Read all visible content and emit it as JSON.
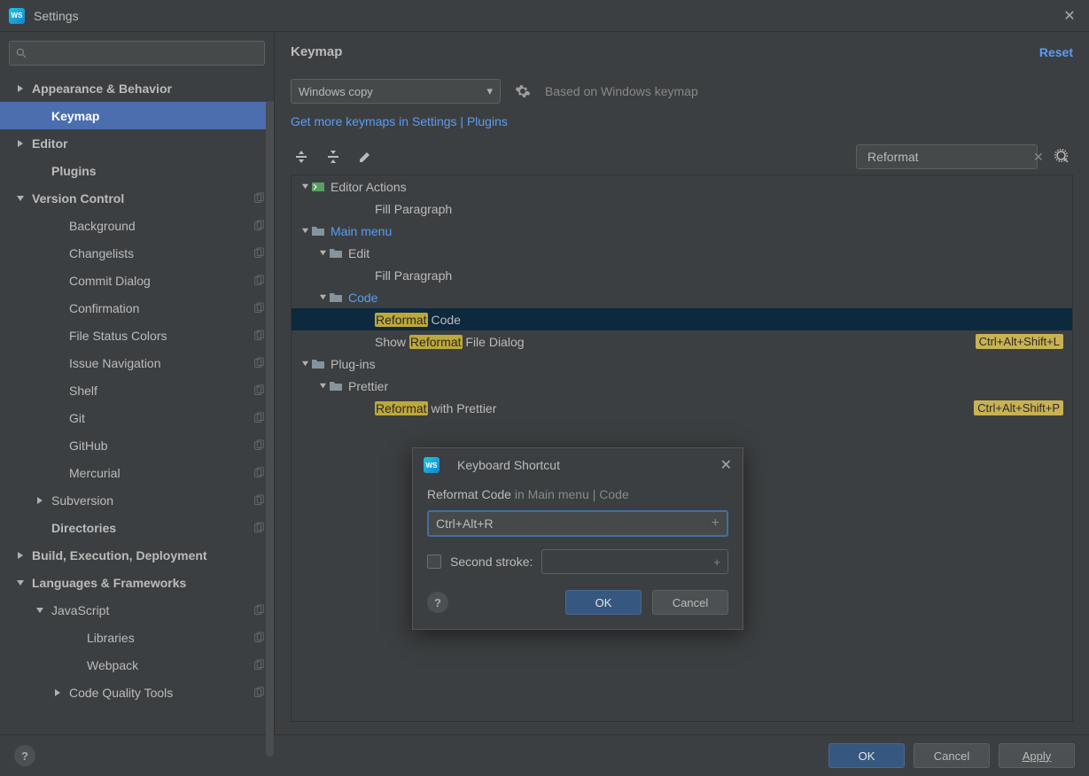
{
  "window": {
    "title": "Settings"
  },
  "sidebar": {
    "items": [
      {
        "label": "Appearance & Behavior",
        "indent": 0,
        "arrow": "right",
        "bold": true
      },
      {
        "label": "Keymap",
        "indent": 1,
        "arrow": "",
        "bold": true,
        "selected": true
      },
      {
        "label": "Editor",
        "indent": 0,
        "arrow": "right",
        "bold": true
      },
      {
        "label": "Plugins",
        "indent": 1,
        "arrow": "",
        "bold": true
      },
      {
        "label": "Version Control",
        "indent": 0,
        "arrow": "down",
        "bold": true,
        "copy": true
      },
      {
        "label": "Background",
        "indent": 2,
        "arrow": "",
        "copy": true
      },
      {
        "label": "Changelists",
        "indent": 2,
        "arrow": "",
        "copy": true
      },
      {
        "label": "Commit Dialog",
        "indent": 2,
        "arrow": "",
        "copy": true
      },
      {
        "label": "Confirmation",
        "indent": 2,
        "arrow": "",
        "copy": true
      },
      {
        "label": "File Status Colors",
        "indent": 2,
        "arrow": "",
        "copy": true
      },
      {
        "label": "Issue Navigation",
        "indent": 2,
        "arrow": "",
        "copy": true
      },
      {
        "label": "Shelf",
        "indent": 2,
        "arrow": "",
        "copy": true
      },
      {
        "label": "Git",
        "indent": 2,
        "arrow": "",
        "copy": true
      },
      {
        "label": "GitHub",
        "indent": 2,
        "arrow": "",
        "copy": true
      },
      {
        "label": "Mercurial",
        "indent": 2,
        "arrow": "",
        "copy": true
      },
      {
        "label": "Subversion",
        "indent": 1,
        "arrow": "right",
        "copy": true
      },
      {
        "label": "Directories",
        "indent": 1,
        "arrow": "",
        "bold": true,
        "copy": true
      },
      {
        "label": "Build, Execution, Deployment",
        "indent": 0,
        "arrow": "right",
        "bold": true
      },
      {
        "label": "Languages & Frameworks",
        "indent": 0,
        "arrow": "down",
        "bold": true
      },
      {
        "label": "JavaScript",
        "indent": 1,
        "arrow": "down",
        "copy": true
      },
      {
        "label": "Libraries",
        "indent": 3,
        "arrow": "",
        "copy": true
      },
      {
        "label": "Webpack",
        "indent": 3,
        "arrow": "",
        "copy": true
      },
      {
        "label": "Code Quality Tools",
        "indent": 2,
        "arrow": "right",
        "copy": true
      }
    ]
  },
  "content": {
    "title": "Keymap",
    "reset": "Reset",
    "keymap_name": "Windows copy",
    "based_on": "Based on Windows keymap",
    "more_keymaps": "Get more keymaps in Settings | Plugins",
    "search_value": "Reformat"
  },
  "keymap_tree": [
    {
      "pad": 0,
      "arrow": "down",
      "icon": "action",
      "label": "Editor Actions"
    },
    {
      "pad": 4,
      "label_plain": "Fill Paragraph"
    },
    {
      "pad": 0,
      "arrow": "down",
      "icon": "folder",
      "label": "Main menu",
      "link": true
    },
    {
      "pad": 1,
      "arrow": "down",
      "icon": "folder",
      "label": "Edit"
    },
    {
      "pad": 4,
      "label_plain": "Fill Paragraph"
    },
    {
      "pad": 1,
      "arrow": "down",
      "icon": "folder",
      "label": "Code",
      "link": true
    },
    {
      "pad": 4,
      "hl": "Reformat",
      "after": " Code",
      "selected": true
    },
    {
      "pad": 4,
      "before": "Show ",
      "hl": "Reformat",
      "after": " File Dialog",
      "shortcut": "Ctrl+Alt+Shift+L"
    },
    {
      "pad": 0,
      "arrow": "down",
      "icon": "folder",
      "label": "Plug-ins"
    },
    {
      "pad": 1,
      "arrow": "down",
      "icon": "folder",
      "label": "Prettier"
    },
    {
      "pad": 4,
      "hl": "Reformat",
      "after": " with Prettier",
      "shortcut": "Ctrl+Alt+Shift+P"
    }
  ],
  "modal": {
    "title": "Keyboard Shortcut",
    "action": "Reformat Code",
    "context": " in Main menu | Code",
    "shortcut": "Ctrl+Alt+R",
    "second_stroke_label": "Second stroke:",
    "ok": "OK",
    "cancel": "Cancel"
  },
  "buttons": {
    "ok": "OK",
    "cancel": "Cancel",
    "apply": "Apply"
  }
}
